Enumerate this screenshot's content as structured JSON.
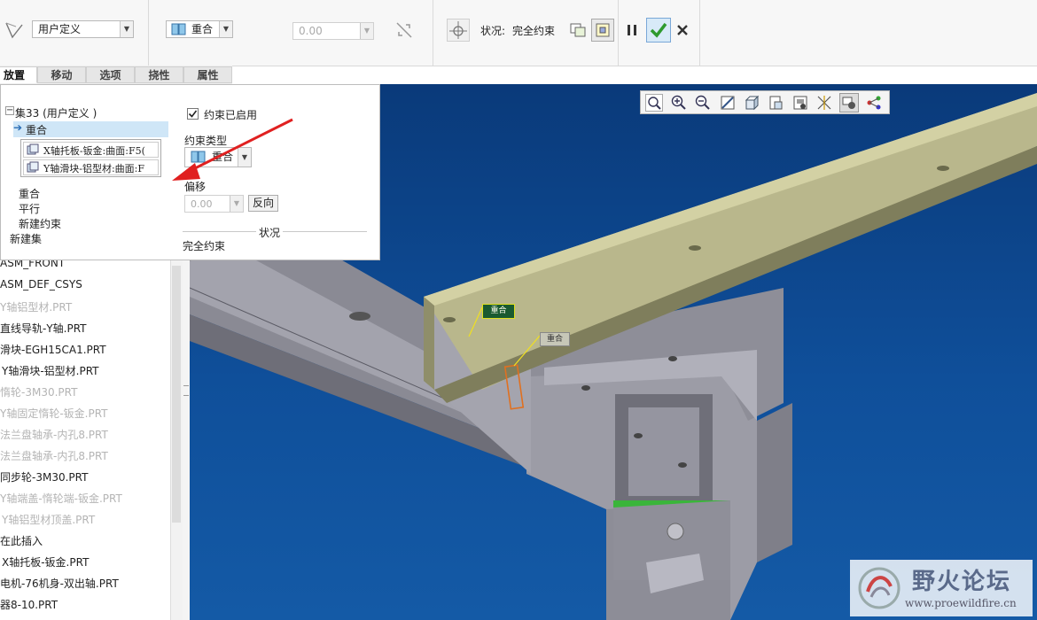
{
  "ribbon": {
    "constraint_set_type": "用户定义",
    "constraint_type": "重合",
    "offset_value": "0.00",
    "status_label": "状况:",
    "status_value": "完全约束"
  },
  "tabs": [
    {
      "label": "放置",
      "active": true
    },
    {
      "label": "移动",
      "active": false
    },
    {
      "label": "选项",
      "active": false
    },
    {
      "label": "挠性",
      "active": false
    },
    {
      "label": "属性",
      "active": false
    }
  ],
  "panel": {
    "set_node": "集33 (用户定义 )",
    "selected_constraint": "重合",
    "ref1": "X轴托板-钣金:曲面:F5(",
    "ref2": "Y轴滑块-铝型材:曲面:F",
    "add_items": [
      "重合",
      "平行",
      "新建约束"
    ],
    "new_set": "新建集",
    "enabled_label": "约束已启用",
    "constraint_type_label": "约束类型",
    "constraint_type_value": "重合",
    "offset_label": "偏移",
    "offset_value": "0.00",
    "flip_button": "反向",
    "status_label": "状况",
    "status_value": "完全约束"
  },
  "tree": {
    "items": [
      {
        "label": "ASM_FRONT",
        "dim": false
      },
      {
        "label": "ASM_DEF_CSYS",
        "dim": false
      },
      {
        "label": "Y轴铝型材.PRT",
        "dim": true
      },
      {
        "label": "直线导轨-Y轴.PRT",
        "dim": false
      },
      {
        "label": "滑块-EGH15CA1.PRT",
        "dim": false
      },
      {
        "label": "Y轴滑块-铝型材.PRT",
        "dim": false
      },
      {
        "label": "惰轮-3M30.PRT",
        "dim": true
      },
      {
        "label": "Y轴固定惰轮-钣金.PRT",
        "dim": true
      },
      {
        "label": "法兰盘轴承-内孔8.PRT",
        "dim": true
      },
      {
        "label": "法兰盘轴承-内孔8.PRT",
        "dim": true
      },
      {
        "label": "同步轮-3M30.PRT",
        "dim": false
      },
      {
        "label": "Y轴端盖-惰轮端-钣金.PRT",
        "dim": true
      },
      {
        "label": "Y轴铝型材顶盖.PRT",
        "dim": true
      },
      {
        "label": "在此插入",
        "dim": false
      },
      {
        "label": "X轴托板-钣金.PRT",
        "dim": false
      },
      {
        "label": "电机-76机身-双出轴.PRT",
        "dim": false
      },
      {
        "label": "器8-10.PRT",
        "dim": false
      }
    ]
  },
  "viewport": {
    "tag1": "重合",
    "tag2": "重合"
  },
  "watermark": {
    "title": "野火论坛",
    "url": "www.proewildfire.cn"
  },
  "colors": {
    "viewport_top": "#0a3a7a",
    "viewport_bottom": "#145aa6",
    "selection": "#cfe6f7",
    "arrow_red": "#e02020",
    "ok_green": "#2e9a2e"
  }
}
